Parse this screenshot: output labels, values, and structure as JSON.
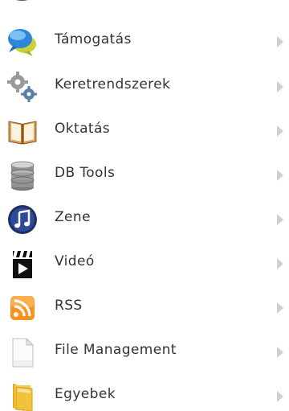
{
  "menu": {
    "items": [
      {
        "label": "Támogatás",
        "icon": "chat-bubbles-icon"
      },
      {
        "label": "Keretrendszerek",
        "icon": "gears-icon"
      },
      {
        "label": "Oktatás",
        "icon": "book-icon"
      },
      {
        "label": "DB Tools",
        "icon": "database-icon"
      },
      {
        "label": "Zene",
        "icon": "music-note-icon"
      },
      {
        "label": "Videó",
        "icon": "clapperboard-icon"
      },
      {
        "label": "RSS",
        "icon": "rss-icon"
      },
      {
        "label": "File Management",
        "icon": "document-icon"
      },
      {
        "label": "Egyebek",
        "icon": "folder-icon"
      }
    ]
  },
  "colors": {
    "text": "#333333",
    "chevron": "#cfcfcf",
    "rss": "#f7931e"
  }
}
